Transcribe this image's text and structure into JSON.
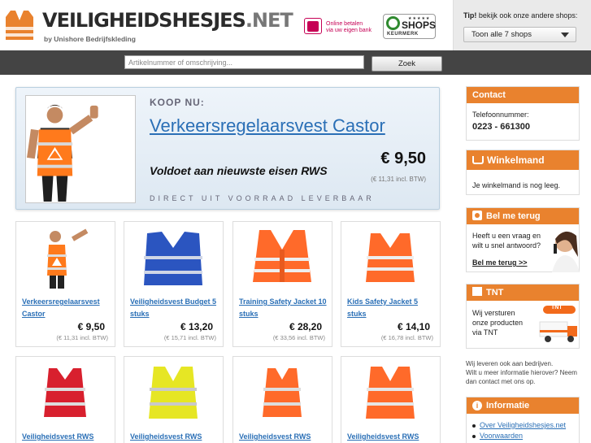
{
  "header": {
    "logo_main": "VEILIGHEIDSHESJES",
    "logo_ext": ".NET",
    "logo_sub": "by Unishore Bedrijfskleding",
    "ideal_line1": "Online betalen",
    "ideal_line2": "via uw eigen bank",
    "qshops_stars": "★★★★★",
    "qshops_name": "SHOPS",
    "qshops_keurmerk": "KEURMERK",
    "tip_label": "Tip!",
    "tip_text": " bekijk ook onze andere shops:",
    "shops_select": "Toon alle 7 shops"
  },
  "search": {
    "placeholder": "Artikelnummer of omschrijving...",
    "button": "Zoek"
  },
  "hero": {
    "koop_label": "KOOP NU:",
    "title": "Verkeersregelaarsvest Castor",
    "price": "€ 9,50",
    "btw": "(€ 11,31 incl. BTW)",
    "claim": "Voldoet aan nieuwste eisen RWS",
    "stock": "DIRECT UIT VOORRAAD LEVERBAAR"
  },
  "products": [
    {
      "name": "Verkeersregelaarsvest Castor",
      "price": "€ 9,50",
      "btw": "(€ 11,31 incl. BTW)"
    },
    {
      "name": "Veiligheidsvest Budget 5 stuks",
      "price": "€ 13,20",
      "btw": "(€ 15,71 incl. BTW)"
    },
    {
      "name": "Training Safety Jacket 10 stuks",
      "price": "€ 28,20",
      "btw": "(€ 33,56 incl. BTW)"
    },
    {
      "name": "Kids Safety Jacket 5 stuks",
      "price": "€ 14,10",
      "btw": "(€ 16,78 incl. BTW)"
    },
    {
      "name": "Veiligheidsvest RWS"
    },
    {
      "name": "Veiligheidsvest RWS"
    },
    {
      "name": "Veiligheidsvest RWS"
    },
    {
      "name": "Veiligheidsvest RWS"
    }
  ],
  "sidebar": {
    "contact": {
      "title": "Contact",
      "phone_label": "Telefoonnummer:",
      "phone": "0223 - 661300"
    },
    "cart": {
      "title": "Winkelmand",
      "text": "Je winkelmand is nog leeg."
    },
    "callback": {
      "title": "Bel me terug",
      "line1": "Heeft u een vraag en",
      "line2": "wilt u snel antwoord?",
      "link": "Bel me terug >>"
    },
    "tnt": {
      "title": "TNT",
      "line1": "Wij versturen",
      "line2": "onze producten",
      "line3": "via TNT",
      "logo": "TNT"
    },
    "note": {
      "line1": "Wij leveren ook aan bedrijven.",
      "line2": "Wilt u meer informatie hierover? Neem",
      "line3": "dan contact met ons op."
    },
    "info": {
      "title": "Informatie",
      "links": [
        "Over Veiligheidshesjes.net",
        "Voorwaarden"
      ]
    }
  },
  "colors": {
    "accent": "#e9822e",
    "link": "#2a6fb6",
    "dark_bar": "#444444"
  }
}
